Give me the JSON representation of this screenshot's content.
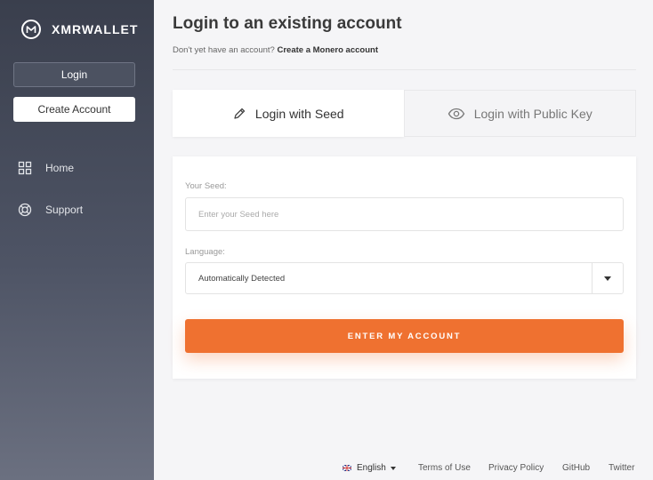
{
  "brand": {
    "name": "XMRWALLET"
  },
  "sidebar": {
    "login_label": "Login",
    "create_label": "Create Account",
    "nav": [
      {
        "label": "Home",
        "icon": "grid-icon"
      },
      {
        "label": "Support",
        "icon": "lifebuoy-icon"
      }
    ]
  },
  "header": {
    "title": "Login to an existing account",
    "subline_text": "Don't yet have an account?",
    "subline_link": "Create a Monero account"
  },
  "tabs": [
    {
      "label": "Login with Seed",
      "icon": "pen-icon",
      "active": true
    },
    {
      "label": "Login with Public Key",
      "icon": "eye-icon",
      "active": false
    }
  ],
  "form": {
    "seed_label": "Your Seed:",
    "seed_placeholder": "Enter your Seed here",
    "seed_value": "",
    "language_label": "Language:",
    "language_value": "Automatically Detected",
    "submit_label": "ENTER MY ACCOUNT"
  },
  "footer": {
    "language": "English",
    "links": [
      "Terms of Use",
      "Privacy Policy",
      "GitHub",
      "Twitter"
    ]
  },
  "colors": {
    "accent": "#ef7130",
    "sidebar_top": "#3a3f4d",
    "sidebar_bottom": "#6b7080"
  }
}
